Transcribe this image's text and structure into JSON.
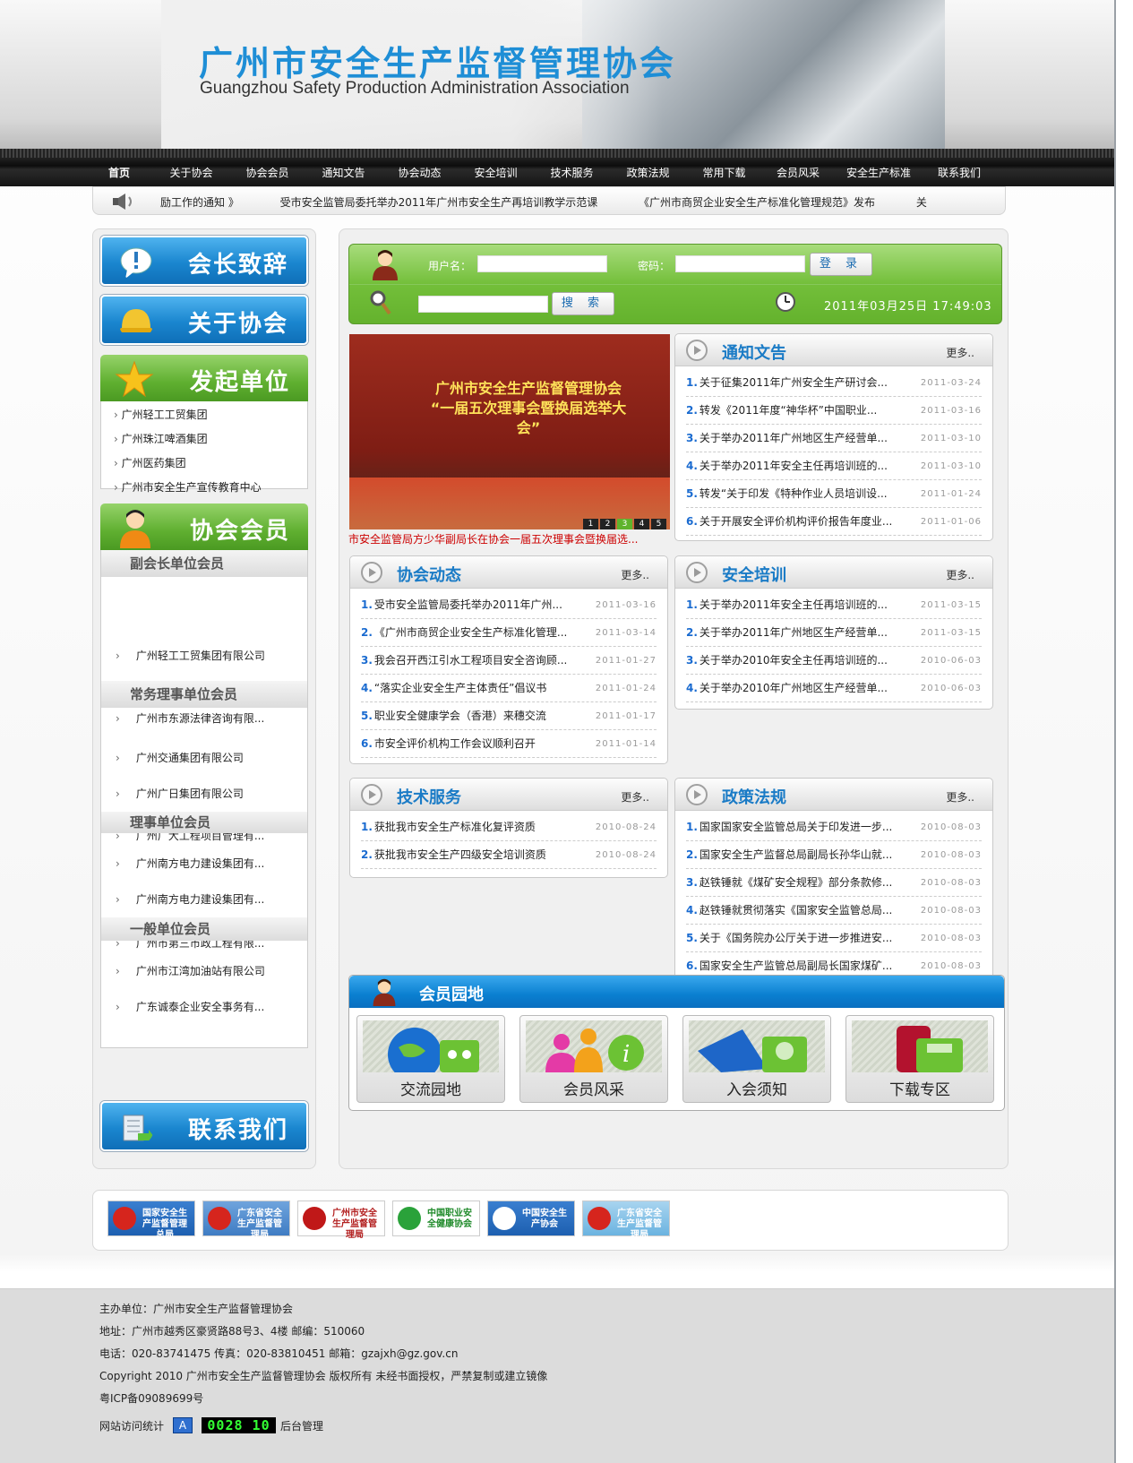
{
  "header": {
    "title": "广州市安全生产监督管理协会",
    "subtitle": "Guangzhou Safety Production Administration Association"
  },
  "nav": [
    "首页",
    "关于协会",
    "协会会员",
    "通知文告",
    "协会动态",
    "安全培训",
    "技术服务",
    "政策法规",
    "常用下载",
    "会员风采",
    "安全生产标准",
    "联系我们"
  ],
  "ticker": [
    "励工作的通知 》",
    "受市安全监管局委托举办2011年广州市安全生产再培训教学示范课",
    "《广州市商贸企业安全生产标准化管理规范》发布",
    "关"
  ],
  "left": {
    "president_btn": "会长致辞",
    "about_btn": "关于协会",
    "founders_title": "发起单位",
    "founders": [
      "广州轻工工贸集团",
      "广州珠江啤酒集团",
      "广州医药集团",
      "广州市安全生产宣传教育中心"
    ],
    "members_title": "协会会员",
    "member_groups": [
      {
        "title": "副会长单位会员",
        "items": [
          "广州轻工工贸集团有限公司"
        ]
      },
      {
        "title": "常务理事单位会员",
        "items": [
          "广州市东源法律咨询有限...",
          "广州交通集团有限公司",
          "广州广日集团有限公司"
        ]
      },
      {
        "title": "理事单位会员",
        "items": [
          "广州广大工程项目管理有...",
          "广州南方电力建设集团有...",
          "广州南方电力建设集团有..."
        ]
      },
      {
        "title": "一般单位会员",
        "items": [
          "广州市第三市政工程有限...",
          "广州市江湾加油站有限公司",
          "广东诚泰企业安全事务有..."
        ]
      }
    ],
    "contact_btn": "联系我们"
  },
  "login": {
    "user_label": "用户名：",
    "pass_label": "密码：",
    "login_btn": "登 录",
    "search_btn": "搜 索",
    "datetime": "2011年03月25日 17:49:03"
  },
  "photo": {
    "banner_line1": "广州市安全生产监督管理协会",
    "banner_line2": "“一届五次理事会暨换届选举大会”",
    "pages": [
      "1",
      "2",
      "3",
      "4",
      "5"
    ],
    "caption": "市安全监管局方少华副局长在协会一届五次理事会暨换届选..."
  },
  "boxes": {
    "more": "更多..",
    "notice": {
      "title": "通知文告",
      "items": [
        {
          "t": "关于征集2011年广州安全生产研讨会...",
          "d": "2011-03-24"
        },
        {
          "t": "转发《2011年度“神华杯”中国职业...",
          "d": "2011-03-16"
        },
        {
          "t": "关于举办2011年广州地区生产经营单...",
          "d": "2011-03-10"
        },
        {
          "t": "关于举办2011年安全主任再培训班的...",
          "d": "2011-03-10"
        },
        {
          "t": "转发“关于印发《特种作业人员培训设...",
          "d": "2011-01-24"
        },
        {
          "t": "关于开展安全评价机构评价报告年度业...",
          "d": "2011-01-06"
        }
      ]
    },
    "news": {
      "title": "协会动态",
      "items": [
        {
          "t": "受市安全监管局委托举办2011年广州...",
          "d": "2011-03-16"
        },
        {
          "t": "《广州市商贸企业安全生产标准化管理...",
          "d": "2011-03-14"
        },
        {
          "t": "我会召开西江引水工程项目安全咨询顾...",
          "d": "2011-01-27"
        },
        {
          "t": "“落实企业安全生产主体责任”倡议书",
          "d": "2011-01-24"
        },
        {
          "t": "职业安全健康学会（香港）来穗交流",
          "d": "2011-01-17"
        },
        {
          "t": "市安全评价机构工作会议顺利召开",
          "d": "2011-01-14"
        }
      ]
    },
    "training": {
      "title": "安全培训",
      "items": [
        {
          "t": "关于举办2011年安全主任再培训班的...",
          "d": "2011-03-15"
        },
        {
          "t": "关于举办2011年广州地区生产经营单...",
          "d": "2011-03-15"
        },
        {
          "t": "关于举办2010年安全主任再培训班的...",
          "d": "2010-06-03"
        },
        {
          "t": "关于举办2010年广州地区生产经营单...",
          "d": "2010-06-03"
        }
      ]
    },
    "tech": {
      "title": "技术服务",
      "items": [
        {
          "t": "获批我市安全生产标准化复评资质",
          "d": "2010-08-24"
        },
        {
          "t": "获批我市安全生产四级安全培训资质",
          "d": "2010-08-24"
        }
      ]
    },
    "policy": {
      "title": "政策法规",
      "items": [
        {
          "t": "国家国家安全监管总局关于印发进一步...",
          "d": "2010-08-03"
        },
        {
          "t": "国家安全生产监督总局副局长孙华山就...",
          "d": "2010-08-03"
        },
        {
          "t": "赵铁锤就《煤矿安全规程》部分条款修...",
          "d": "2010-08-03"
        },
        {
          "t": "赵铁锤就贯彻落实《国家安全监管总局...",
          "d": "2010-08-03"
        },
        {
          "t": "关于《国务院办公厅关于进一步推进安...",
          "d": "2010-08-03"
        },
        {
          "t": "国家安全生产监管总局副局长国家煤矿...",
          "d": "2010-08-03"
        }
      ]
    }
  },
  "garden": {
    "title": "会员园地",
    "tiles": [
      "交流园地",
      "会员风采",
      "入会须知",
      "下载专区"
    ]
  },
  "logos": [
    "国家安全生产监督管理总局",
    "广东省安全生产监督管理局",
    "广州市安全生产监督管理局",
    "中国职业安全健康协会",
    "中国安全生产协会",
    "广东省安全生产监督管理局"
  ],
  "footer": {
    "host": "主办单位：广州市安全生产监督管理协会",
    "address": "地址：广州市越秀区豪贤路88号3、4楼 邮编：510060",
    "contact": "电话：020-83741475 传真：020-83810451 邮箱：gzajxh@gz.gov.cn",
    "copyright": "Copyright 2010 广州市安全生产监督管理协会 版权所有 未经书面授权，严禁复制或建立镜像",
    "icp": "粤ICP备09089699号",
    "stats_label": "网站访问统计",
    "counter": "0028 10",
    "admin_link": "后台管理"
  }
}
